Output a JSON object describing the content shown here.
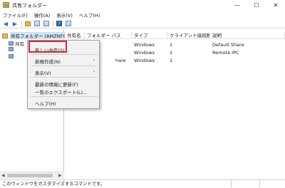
{
  "window": {
    "title": "共有フォルダー",
    "controls": {
      "minimize": "—",
      "maximize": "☐",
      "close": "✕"
    }
  },
  "menubar": {
    "items": [
      "ファイル(F)",
      "操作(A)",
      "表示(V)",
      "ヘルプ(H)"
    ]
  },
  "toolbar": {
    "icons": [
      "back-arrow-icon",
      "forward-arrow-icon",
      "up-folder-icon",
      "properties-icon",
      "show-hide-tree-icon",
      "help-icon",
      "export-list-icon"
    ]
  },
  "tree": {
    "root_label": "共有フォルダー (AMZNFSX",
    "children": [
      "共有",
      "",
      ""
    ]
  },
  "list": {
    "columns": [
      "共有名",
      "フォルダー パス",
      "タイプ",
      "クライアント接続数",
      "説明"
    ],
    "rows": [
      {
        "type": "Windows",
        "clients": "1",
        "description": "Default Share"
      },
      {
        "type": "Windows",
        "clients": "1",
        "description": "Remote IPC"
      },
      {
        "path_partial": "hare",
        "type": "Windows",
        "clients": "1",
        "description": ""
      }
    ]
  },
  "context_menu": {
    "items": [
      {
        "label": "新しい共有(S)...",
        "submenu": false
      },
      {
        "label": "新規作成(N)",
        "submenu": true
      },
      {
        "label": "表示(V)",
        "submenu": true
      },
      {
        "label": "最新の情報に更新(F)",
        "submenu": false
      },
      {
        "label": "一覧のエクスポート(L)...",
        "submenu": false
      },
      {
        "label": "ヘルプ(H)",
        "submenu": false
      }
    ],
    "submenu_arrow": "›",
    "highlight_color": "#e0242a"
  },
  "statusbar": {
    "text": "このウィンドウをカスタマイズするコマンドです。"
  },
  "colors": {
    "selection": "#cde4f7",
    "folder": "#e2b84a",
    "accent": "#2d6fc2"
  }
}
